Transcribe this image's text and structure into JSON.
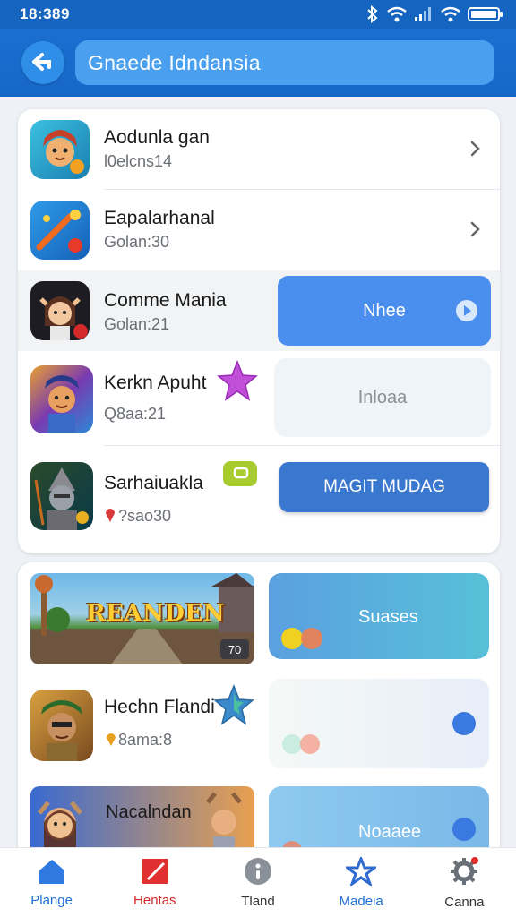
{
  "status_bar": {
    "time": "18:389"
  },
  "header": {
    "title": "Gnaede Idndansia"
  },
  "list": {
    "items": [
      {
        "title": "Aodunla gan",
        "subtitle": "l0elcns14"
      },
      {
        "title": "Eapalarhanal",
        "subtitle": "Golan:30"
      },
      {
        "title": "Comme Mania",
        "subtitle": "Golan:21",
        "button": "Nhee"
      },
      {
        "title": "Kerkn Apuht",
        "subtitle": "Q8aa:21",
        "button": "Inloaa"
      },
      {
        "title": "Sarhaiuakla",
        "subtitle": "?sao30",
        "button": "MAGIT MUDAG"
      }
    ]
  },
  "featured": {
    "banner_text": "REANDEN",
    "banner_badge": "70",
    "banner_card_label": "Suases",
    "items": [
      {
        "title": "Hechn Flandi",
        "subtitle": "8ama:8"
      },
      {
        "title": "Nacalndan",
        "card_label": "Noaaee"
      }
    ]
  },
  "nav": {
    "items": [
      {
        "label": "Plange",
        "color": "#1f6fd6"
      },
      {
        "label": "Hentas",
        "color": "#d22a2a"
      },
      {
        "label": "Tland",
        "color": "#333333"
      },
      {
        "label": "Madeia",
        "color": "#1f6fd6"
      },
      {
        "label": "Canna",
        "color": "#333333"
      }
    ]
  },
  "colors": {
    "primary": "#1565c0",
    "accent_button": "#4a8eee",
    "nav_active": "#1f6fd6",
    "nav_red": "#d22a2a"
  }
}
